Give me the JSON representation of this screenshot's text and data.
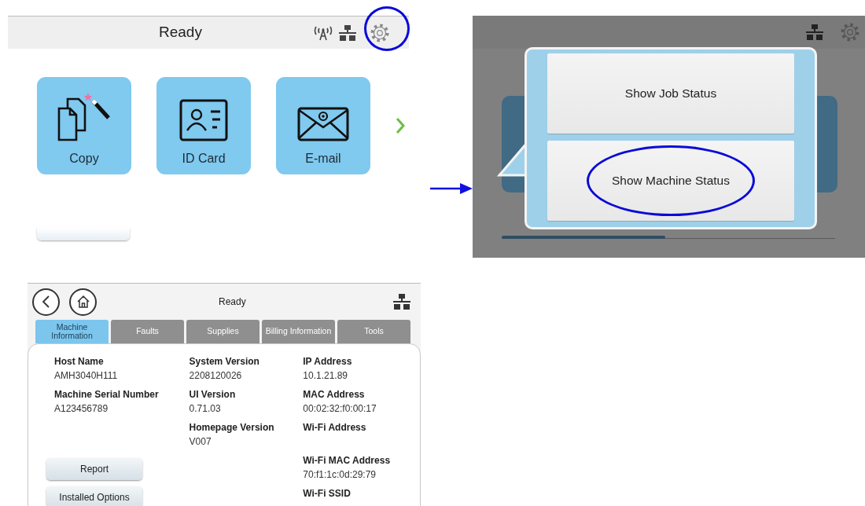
{
  "home_screen": {
    "title": "Ready",
    "settings_circled": true,
    "tiles": [
      {
        "label": "Copy",
        "kind": "copy"
      },
      {
        "label": "ID Card",
        "kind": "id-card"
      },
      {
        "label": "E-mail",
        "kind": "email"
      }
    ]
  },
  "menu_screen": {
    "options": [
      {
        "label": "Show Job Status",
        "circled": false
      },
      {
        "label": "Show Machine Status",
        "circled": true
      }
    ]
  },
  "machine_status": {
    "title": "Ready",
    "tabs": [
      {
        "label": "Machine Information",
        "selected": true
      },
      {
        "label": "Faults",
        "selected": false
      },
      {
        "label": "Supplies",
        "selected": false
      },
      {
        "label": "Billing Information",
        "selected": false
      },
      {
        "label": "Tools",
        "selected": false
      }
    ],
    "columns": [
      [
        {
          "label": "Host Name",
          "value": "AMH3040H111"
        },
        {
          "label": "Machine Serial Number",
          "value": "A123456789"
        }
      ],
      [
        {
          "label": "System Version",
          "value": "2208120026"
        },
        {
          "label": "UI Version",
          "value": "0.71.03"
        },
        {
          "label": "Homepage Version",
          "value": "V007"
        }
      ],
      [
        {
          "label": "IP Address",
          "value": "10.1.21.89"
        },
        {
          "label": "MAC Address",
          "value": "00:02:32:f0:00:17"
        },
        {
          "label": "Wi-Fi Address"
        },
        {
          "label": "Wi-Fi MAC Address",
          "value": "70:f1:1c:0d:29:79"
        },
        {
          "label": "Wi-Fi SSID"
        }
      ]
    ],
    "buttons": [
      "Report",
      "Installed Options"
    ]
  }
}
